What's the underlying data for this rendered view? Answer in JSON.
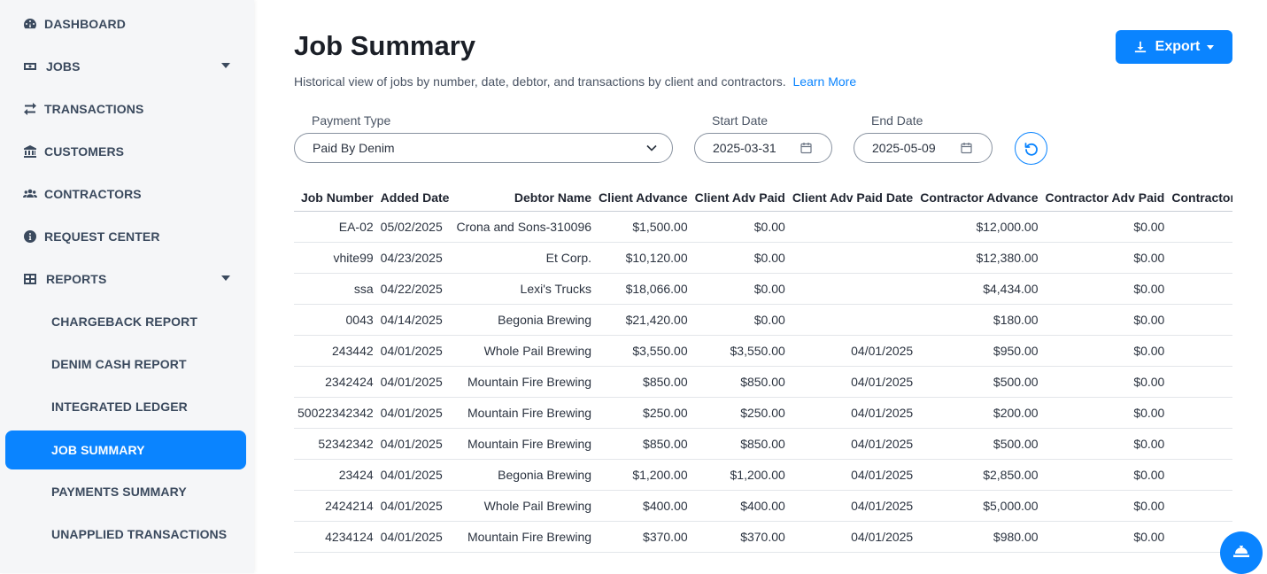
{
  "sidebar": {
    "items": [
      {
        "label": "DASHBOARD"
      },
      {
        "label": "JOBS"
      },
      {
        "label": "TRANSACTIONS"
      },
      {
        "label": "CUSTOMERS"
      },
      {
        "label": "CONTRACTORS"
      },
      {
        "label": "REQUEST CENTER"
      },
      {
        "label": "REPORTS"
      }
    ],
    "sub_items": [
      {
        "label": "CHARGEBACK REPORT"
      },
      {
        "label": "DENIM CASH REPORT"
      },
      {
        "label": "INTEGRATED LEDGER"
      },
      {
        "label": "JOB SUMMARY"
      },
      {
        "label": "PAYMENTS SUMMARY"
      },
      {
        "label": "UNAPPLIED TRANSACTIONS"
      }
    ]
  },
  "page": {
    "title": "Job Summary",
    "subtitle": "Historical view of jobs by number, date, debtor, and transactions by client and contractors.",
    "learn_more": "Learn More",
    "export_label": "Export"
  },
  "filters": {
    "payment_type_label": "Payment Type",
    "payment_type_value": "Paid By Denim",
    "start_date_label": "Start Date",
    "start_date_value": "2025-03-31",
    "end_date_label": "End Date",
    "end_date_value": "2025-05-09"
  },
  "table": {
    "headers": [
      "Job Number",
      "Added Date",
      "Debtor Name",
      "Client Advance",
      "Client Adv Paid",
      "Client Adv Paid Date",
      "Contractor Advance",
      "Contractor Adv Paid",
      "Contractor Adv"
    ],
    "rows": [
      [
        "EA-02",
        "05/02/2025",
        "Crona and Sons-310096",
        "$1,500.00",
        "$0.00",
        "",
        "$12,000.00",
        "$0.00",
        ""
      ],
      [
        "vhite99",
        "04/23/2025",
        "Et Corp.",
        "$10,120.00",
        "$0.00",
        "",
        "$12,380.00",
        "$0.00",
        ""
      ],
      [
        "ssa",
        "04/22/2025",
        "Lexi's Trucks",
        "$18,066.00",
        "$0.00",
        "",
        "$4,434.00",
        "$0.00",
        ""
      ],
      [
        "0043",
        "04/14/2025",
        "Begonia Brewing",
        "$21,420.00",
        "$0.00",
        "",
        "$180.00",
        "$0.00",
        ""
      ],
      [
        "243442",
        "04/01/2025",
        "Whole Pail Brewing",
        "$3,550.00",
        "$3,550.00",
        "04/01/2025",
        "$950.00",
        "$0.00",
        ""
      ],
      [
        "2342424",
        "04/01/2025",
        "Mountain Fire Brewing",
        "$850.00",
        "$850.00",
        "04/01/2025",
        "$500.00",
        "$0.00",
        ""
      ],
      [
        "50022342342",
        "04/01/2025",
        "Mountain Fire Brewing",
        "$250.00",
        "$250.00",
        "04/01/2025",
        "$200.00",
        "$0.00",
        ""
      ],
      [
        "52342342",
        "04/01/2025",
        "Mountain Fire Brewing",
        "$850.00",
        "$850.00",
        "04/01/2025",
        "$500.00",
        "$0.00",
        ""
      ],
      [
        "23424",
        "04/01/2025",
        "Begonia Brewing",
        "$1,200.00",
        "$1,200.00",
        "04/01/2025",
        "$2,850.00",
        "$0.00",
        ""
      ],
      [
        "2424214",
        "04/01/2025",
        "Whole Pail Brewing",
        "$400.00",
        "$400.00",
        "04/01/2025",
        "$5,000.00",
        "$0.00",
        ""
      ],
      [
        "4234124",
        "04/01/2025",
        "Mountain Fire Brewing",
        "$370.00",
        "$370.00",
        "04/01/2025",
        "$980.00",
        "$0.00",
        ""
      ]
    ]
  },
  "colors": {
    "accent": "#0a84ff",
    "sidebar_bg": "#f5f6f8",
    "nav_text": "#3b4a5e"
  }
}
